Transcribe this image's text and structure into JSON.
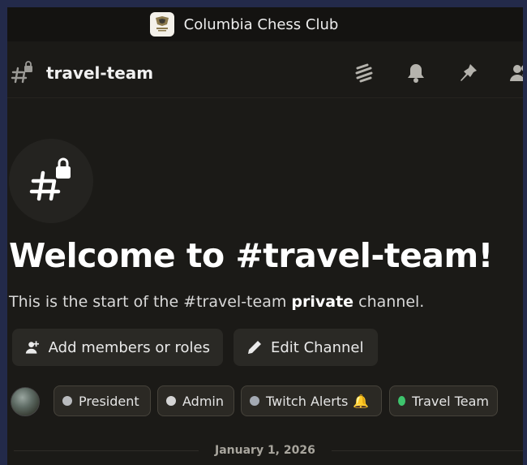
{
  "server": {
    "name": "Columbia Chess Club",
    "logo_icon": "chess-club-logo"
  },
  "channel": {
    "name": "travel-team",
    "icon": "private-channel-hash-lock-icon",
    "header_icons": [
      "threads-icon",
      "bell-icon",
      "pin-icon",
      "members-icon"
    ]
  },
  "welcome": {
    "title": "Welcome to #travel-team!",
    "subtitle_prefix": "This is the start of the #travel-team ",
    "subtitle_bold": "private",
    "subtitle_suffix": " channel."
  },
  "actions": {
    "add_members_label": "Add members or roles",
    "edit_channel_label": "Edit Channel"
  },
  "roles": [
    {
      "name": "President",
      "color": "#b9bbbe"
    },
    {
      "name": "Admin",
      "color": "#d4d4d4"
    },
    {
      "name": "Twitch Alerts",
      "color": "#a4aab3",
      "emoji": "🔔"
    },
    {
      "name": "Travel Team",
      "color": "#3ec46d"
    }
  ],
  "divider": {
    "date": "January 1, 2026"
  }
}
